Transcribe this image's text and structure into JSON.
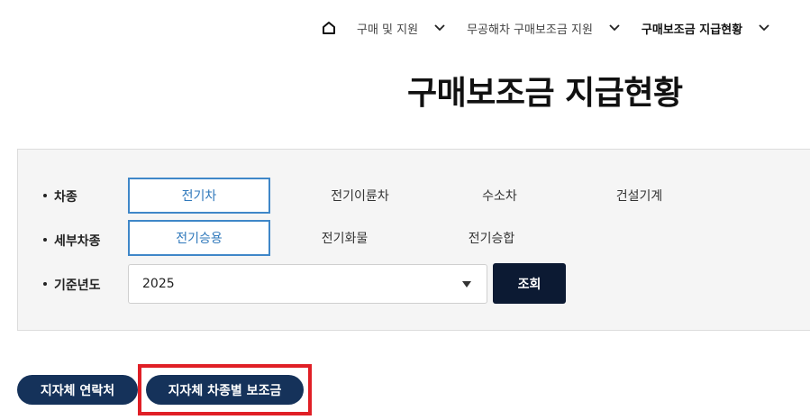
{
  "breadcrumb": {
    "home_icon": "home-icon",
    "items": [
      {
        "label": "구매 및 지원"
      },
      {
        "label": "무공해차 구매보조금 지원"
      },
      {
        "label": "구매보조금 지급현황"
      }
    ]
  },
  "page_title": "구매보조금 지급현황",
  "filters": {
    "vehicle_type": {
      "label": "차종",
      "options": [
        "전기차",
        "전기이륜차",
        "수소차",
        "건설기계"
      ],
      "selected": "전기차"
    },
    "sub_type": {
      "label": "세부차종",
      "options": [
        "전기승용",
        "전기화물",
        "전기승합"
      ],
      "selected": "전기승용"
    },
    "year": {
      "label": "기준년도",
      "value": "2025"
    },
    "search_label": "조회"
  },
  "actions": {
    "contacts_label": "지자체 연락처",
    "subsidy_label": "지자체 차종별 보조금"
  },
  "colors": {
    "accent": "#3f87c8",
    "navy": "#0c1a33",
    "pill": "#15325a",
    "highlight": "#e01f26"
  }
}
